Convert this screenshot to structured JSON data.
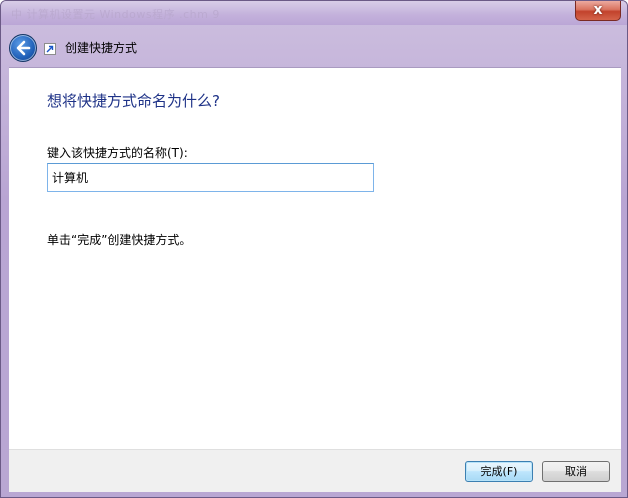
{
  "window": {
    "ghost_title": "中 计算机设置元 Windows程序 .chm 9",
    "close_symbol": "x"
  },
  "nav": {
    "title": "创建快捷方式",
    "back_icon": "back-arrow-icon",
    "shortcut_icon": "shortcut-arrow-icon"
  },
  "main": {
    "heading": "想将快捷方式命名为什么?",
    "field_label": "键入该快捷方式的名称(T):",
    "name_value": "计算机",
    "hint": "单击“完成”创建快捷方式。"
  },
  "footer": {
    "finish_label": "完成(F)",
    "cancel_label": "取消"
  },
  "colors": {
    "heading": "#1e3287",
    "frame": "#b9a7d3",
    "close_button": "#c2422c"
  }
}
